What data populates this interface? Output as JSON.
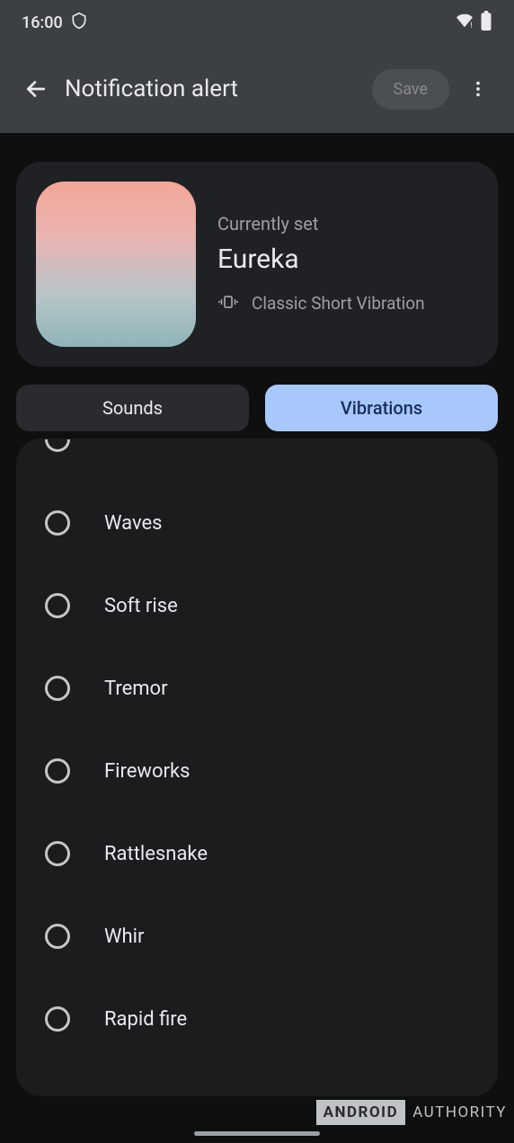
{
  "statusbar": {
    "time": "16:00"
  },
  "header": {
    "title": "Notification alert",
    "save_label": "Save"
  },
  "current": {
    "label": "Currently set",
    "name": "Eureka",
    "vibration_text": "Classic Short Vibration"
  },
  "tabs": {
    "sounds": "Sounds",
    "vibrations": "Vibrations"
  },
  "items": [
    {
      "label": "Waves"
    },
    {
      "label": "Soft rise"
    },
    {
      "label": "Tremor"
    },
    {
      "label": "Fireworks"
    },
    {
      "label": "Rattlesnake"
    },
    {
      "label": "Whir"
    },
    {
      "label": "Rapid fire"
    }
  ],
  "watermark": {
    "left": "ANDROID",
    "right": "AUTHORITY"
  }
}
